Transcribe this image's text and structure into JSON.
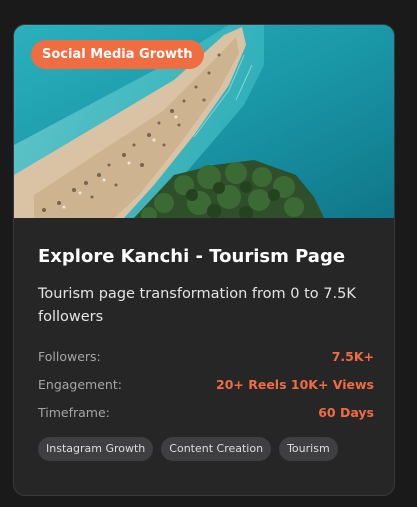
{
  "card": {
    "badge": "Social Media Growth",
    "image_alt": "aerial-beach",
    "title": "Explore Kanchi - Tourism Page",
    "description": "Tourism page transformation from 0 to 7.5K followers",
    "stats": [
      {
        "label": "Followers:",
        "value": "7.5K+"
      },
      {
        "label": "Engagement:",
        "value": "20+ Reels 10K+ Views"
      },
      {
        "label": "Timeframe:",
        "value": "60 Days"
      }
    ],
    "tags": [
      "Instagram Growth",
      "Content Creation",
      "Tourism"
    ]
  },
  "colors": {
    "accent": "#f06d41",
    "card_bg": "#262627",
    "page_bg": "#1a1a1a",
    "tag_bg": "#3f3f42"
  }
}
